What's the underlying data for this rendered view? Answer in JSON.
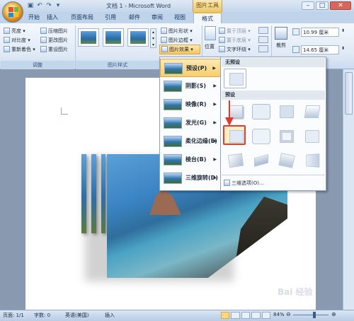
{
  "window": {
    "title": "文档 1 - Microsoft Word",
    "context_tab": "图片工具"
  },
  "tabs": [
    {
      "label": "开始"
    },
    {
      "label": "插入"
    },
    {
      "label": "页面布局"
    },
    {
      "label": "引用"
    },
    {
      "label": "邮件"
    },
    {
      "label": "审阅"
    },
    {
      "label": "视图"
    },
    {
      "label": "格式"
    }
  ],
  "ribbon": {
    "adjust": {
      "brightness": "亮度",
      "contrast": "对比度",
      "recolor": "重新着色",
      "compress": "压缩图片",
      "change": "更改图片",
      "reset": "重设图片",
      "group_label": "调整"
    },
    "styles": {
      "group_label": "图片样式",
      "shape": "图片形状",
      "border": "图片边框",
      "effects": "图片效果"
    },
    "arrange": {
      "position": "位置",
      "front": "置于顶层",
      "back": "置于底层",
      "wrap": "文字环绕"
    },
    "size": {
      "crop": "裁剪",
      "height": "10.99 厘米",
      "width": "14.65 厘米"
    }
  },
  "effects_menu": {
    "items": [
      {
        "label": "预设(P)"
      },
      {
        "label": "阴影(S)"
      },
      {
        "label": "映像(R)"
      },
      {
        "label": "发光(G)"
      },
      {
        "label": "柔化边缘(E)"
      },
      {
        "label": "棱台(B)"
      },
      {
        "label": "三维旋转(D)"
      }
    ]
  },
  "preset_submenu": {
    "no_preset": "无预设",
    "presets": "预设",
    "options": "三维选项(O)..."
  },
  "status": {
    "page": "页面: 1/1",
    "words": "字数: 0",
    "language": "英语(美国)",
    "mode": "插入",
    "zoom": "84%"
  },
  "watermark": "Bai 经验",
  "colors": {
    "accent": "#e7b94a",
    "highlight": "#e03a2c"
  }
}
